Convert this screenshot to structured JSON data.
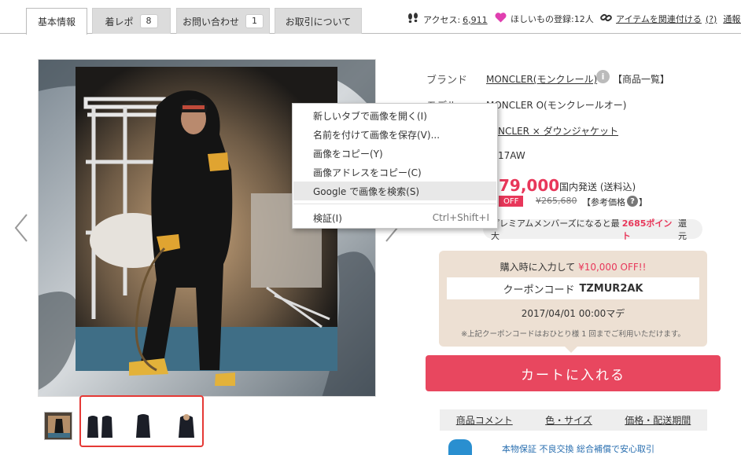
{
  "tabs": [
    {
      "label": "基本情報"
    },
    {
      "label": "着レポ",
      "count": "8"
    },
    {
      "label": "お問い合わせ",
      "count": "1"
    },
    {
      "label": "お取引について"
    }
  ],
  "stats": {
    "access_label": "アクセス:",
    "access_value": "6,911",
    "wishlist": "ほしいもの登録:12人",
    "relate_link": "アイテムを関連付ける",
    "relate_help": "(?)",
    "report_link": "通報す"
  },
  "product": {
    "brand_label": "ブランド",
    "brand_value": "MONCLER(モンクレール)",
    "brand_list_link": "【商品一覧】",
    "model_label": "モデル",
    "model_value": "MONCLER O(モンクレールオー)",
    "category_value": "NCLER × ダウンジャケット",
    "season_value": "17AW",
    "price": "79,000",
    "shipping": "国内発送 (送料込)",
    "off_tag": "OFF",
    "ref_price": "¥265,680",
    "ref_label": "【参考価格",
    "ref_help": "?",
    "ref_close": "】",
    "premium_prefix": "プレミアムメンバーズになると最大",
    "premium_points": "2685ポイント",
    "premium_suffix": "還元"
  },
  "coupon": {
    "headline_prefix": "購入時に入力して",
    "headline_amount": "¥10,000 OFF!!",
    "code_label": "クーポンコード",
    "code": "TZMUR2AK",
    "deadline": "2017/04/01 00:00マデ",
    "note": "※上記クーポンコードはおひとり様 1 回までご利用いただけます。"
  },
  "cart_button": "カートに入れる",
  "bottom_tabs": [
    "商品コメント",
    "色・サイズ",
    "価格・配送期間"
  ],
  "bottom_partial": "本物保証  不良交換  総合補償で安心取引",
  "context_menu": [
    {
      "label": "新しいタブで画像を開く(I)"
    },
    {
      "label": "名前を付けて画像を保存(V)..."
    },
    {
      "label": "画像をコピー(Y)"
    },
    {
      "label": "画像アドレスをコピー(C)"
    },
    {
      "label": "Google で画像を検索(S)"
    },
    {
      "label": "検証(I)",
      "shortcut": "Ctrl+Shift+I"
    }
  ],
  "icons": {
    "footprint": "footprints-icon",
    "heart": "heart-icon",
    "link": "link-icon",
    "info": "info-icon",
    "prev": "chevron-left-icon",
    "next": "chevron-right-icon"
  },
  "colors": {
    "accent": "#e8375a",
    "cart": "#e8475f",
    "coupon_bg": "#ede0d3",
    "heart": "#e03fb0",
    "highlight_border": "#e53935"
  }
}
